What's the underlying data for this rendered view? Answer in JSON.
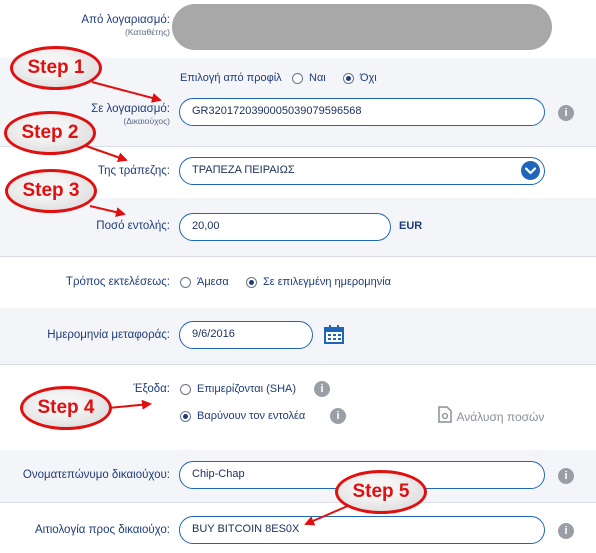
{
  "from_account": {
    "label": "Από λογαριασμό:",
    "sublabel": "(Καταθέτης)"
  },
  "profile": {
    "label": "Επιλογή από προφίλ",
    "opt_yes": "Ναι",
    "opt_no": "Όχι",
    "selected": "no"
  },
  "to_account": {
    "label": "Σε λογαριασμό:",
    "sublabel": "(Δικαιούχος)",
    "value": "GR3201720390005039079596568"
  },
  "bank": {
    "label": "Της τράπεζης:",
    "value": "ΤΡΑΠΕΖΑ ΠΕΙΡΑΙΩΣ"
  },
  "amount": {
    "label": "Ποσό εντολής:",
    "value": "20,00",
    "currency": "EUR"
  },
  "execution": {
    "label": "Τρόπος εκτελέσεως:",
    "opt_now": "Άμεσα",
    "opt_date": "Σε επιλεγμένη ημερομηνία",
    "selected": "date"
  },
  "transfer_date": {
    "label": "Ημερομηνία μεταφοράς:",
    "value": "9/6/2016"
  },
  "charges": {
    "label": "Έξοδα:",
    "opt_shared": "Επιμερίζονται (SHA)",
    "opt_payer": "Βαρύνουν τον εντολέα",
    "selected": "payer",
    "analysis": "Ανάλυση ποσών"
  },
  "beneficiary_name": {
    "label": "Ονοματεπώνυμο δικαιούχου:",
    "value": "Chip-Chap"
  },
  "reason": {
    "label": "Αιτιολογία προς δικαιούχο:",
    "value": "BUY BITCOIN 8ES0X"
  },
  "steps": [
    "Step 1",
    "Step 2",
    "Step 3",
    "Step 4",
    "Step 5"
  ],
  "colors": {
    "accent": "#1f66b8",
    "navy": "#1f3c7a",
    "step_red": "#e01010"
  }
}
